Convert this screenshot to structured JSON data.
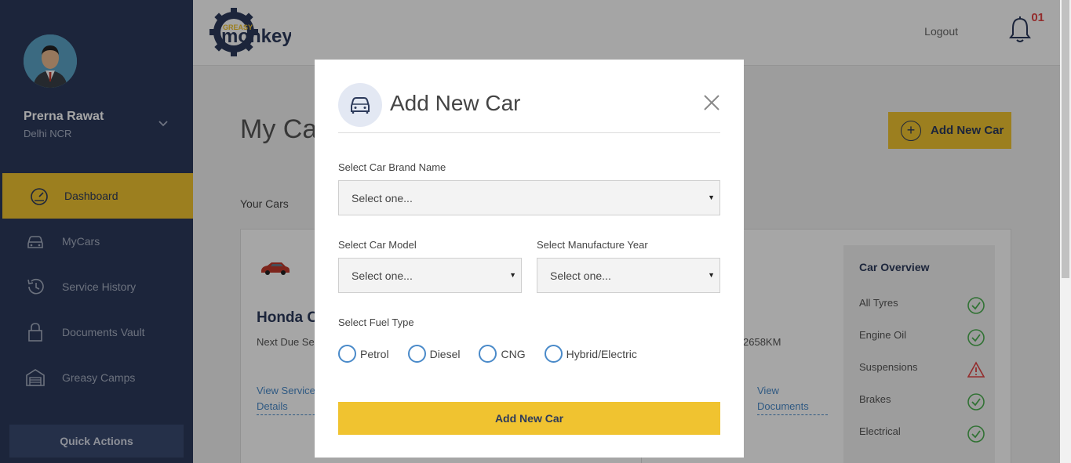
{
  "sidebar": {
    "user_name": "Prerna Rawat",
    "user_location": "Delhi NCR",
    "items": [
      {
        "label": "Dashboard",
        "icon": "speedometer-icon",
        "active": true
      },
      {
        "label": "MyCars",
        "icon": "car-icon",
        "active": false
      },
      {
        "label": "Service History",
        "icon": "history-icon",
        "active": false
      },
      {
        "label": "Documents Vault",
        "icon": "lock-icon",
        "active": false
      },
      {
        "label": "Greasy Camps",
        "icon": "garage-icon",
        "active": false
      }
    ],
    "quick_actions": "Quick Actions"
  },
  "header": {
    "logo_text_top": "GREASY",
    "logo_text": "monkey",
    "logout": "Logout",
    "notification_count": "01"
  },
  "main": {
    "title": "My Cars",
    "add_button": "Add New Car",
    "your_cars": "Your Cars",
    "car": {
      "name": "Honda City",
      "next_due": "Next Due Service",
      "km": "2658KM",
      "view_service": "View Service Details",
      "view_documents": "View Documents"
    },
    "overview": {
      "title": "Car Overview",
      "rows": [
        {
          "label": "All Tyres",
          "status": "ok"
        },
        {
          "label": "Engine Oil",
          "status": "ok"
        },
        {
          "label": "Suspensions",
          "status": "warning"
        },
        {
          "label": "Brakes",
          "status": "ok"
        },
        {
          "label": "Electrical",
          "status": "ok"
        }
      ]
    }
  },
  "modal": {
    "title": "Add New Car",
    "brand_label": "Select Car Brand Name",
    "brand_value": "Select one...",
    "model_label": "Select Car Model",
    "model_value": "Select one...",
    "year_label": "Select Manufacture Year",
    "year_value": "Select one...",
    "fuel_label": "Select Fuel Type",
    "fuel_options": [
      "Petrol",
      "Diesel",
      "CNG",
      "Hybrid/Electric"
    ],
    "submit": "Add New Car"
  },
  "colors": {
    "sidebar_bg": "#2c3a5b",
    "accent": "#f0c330",
    "link": "#4a8ac9",
    "ok": "#4caf50",
    "warning": "#e24545"
  }
}
